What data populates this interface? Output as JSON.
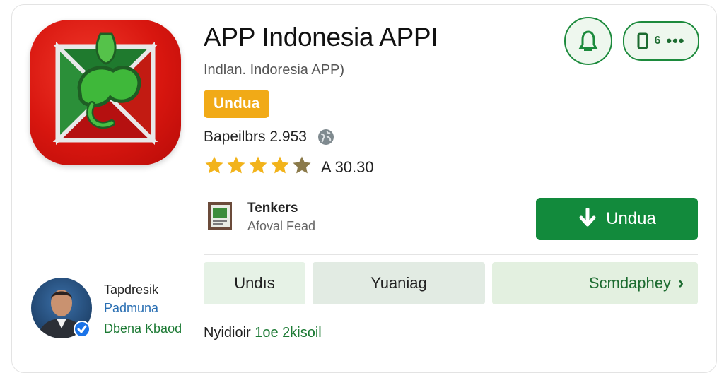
{
  "app": {
    "title": "APP Indonesia APPI",
    "subtitle": "Indlan. Indoresia APP)",
    "badge": "Undua",
    "downloads": "Bapeilbrs 2.953",
    "rating_text": "A 30.30",
    "stars": 4.5
  },
  "header_buttons": {
    "more_number": "6",
    "more_dots": "•••"
  },
  "developer": {
    "name": "Tenkers",
    "subtitle": "Afoval Fead"
  },
  "install": {
    "label": "Undua"
  },
  "author": {
    "name": "Tapdresik",
    "role": "Padmuna",
    "org": "Dbena Kbaod"
  },
  "tabs": [
    {
      "label": "Undıs"
    },
    {
      "label": "Yuaniag"
    },
    {
      "label": "Scmdaphey"
    }
  ],
  "footer": {
    "label": "Nyidioir",
    "value": "1oe 2kisoil"
  },
  "colors": {
    "brand_green": "#128a3c",
    "badge_orange": "#f1aa17",
    "icon_red": "#d8160f",
    "star_gold": "#f2b31b"
  }
}
